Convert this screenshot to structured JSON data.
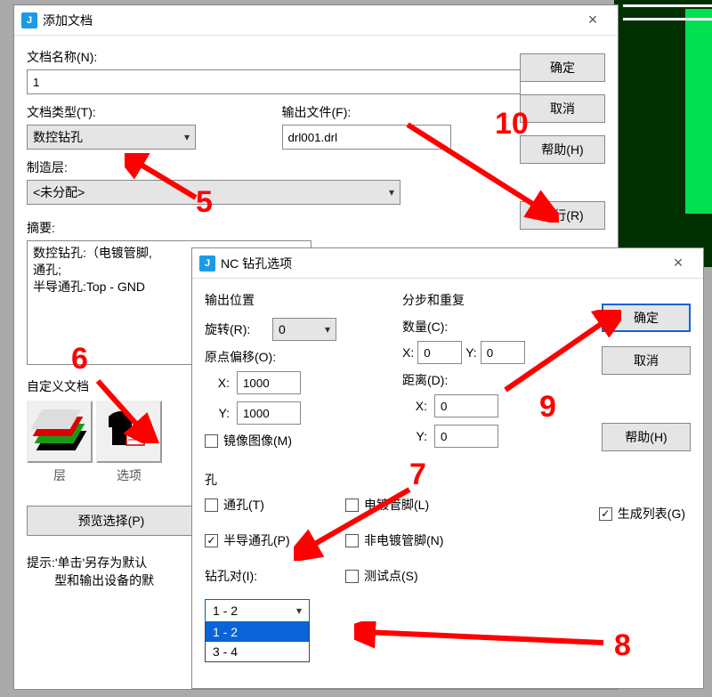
{
  "dlg1": {
    "title": "添加文档",
    "doc_name_label": "文档名称(N):",
    "doc_name_value": "1",
    "doc_type_label": "文档类型(T):",
    "doc_type_value": "数控钻孔",
    "output_file_label": "输出文件(F):",
    "output_file_value": "drl001.drl",
    "make_layer_label": "制造层:",
    "make_layer_value": "<未分配>",
    "summary_label": "摘要:",
    "summary_line1": "数控钻孔:（电镀管脚,",
    "summary_line2": "通孔;",
    "summary_line3": "半导通孔:Top - GND",
    "custom_doc_label": "自定义文档",
    "layer_caption": "层",
    "options_caption": "选项",
    "preview_btn": "预览选择(P)",
    "hint1": "提示:'单击'另存为默认",
    "hint2": "型和输出设备的默",
    "ok": "确定",
    "cancel": "取消",
    "help": "帮助(H)",
    "run": "运行(R)"
  },
  "dlg2": {
    "title": "NC 钻孔选项",
    "output_position": "输出位置",
    "rotation_label": "旋转(R):",
    "rotation_value": "0",
    "origin_offset_label": "原点偏移(O):",
    "origin_x_label": "X:",
    "origin_x_value": "1000",
    "origin_y_label": "Y:",
    "origin_y_value": "1000",
    "mirror_label": "镜像图像(M)",
    "step_repeat": "分步和重复",
    "count_label": "数量(C):",
    "count_x_label": "X:",
    "count_x_value": "0",
    "count_y_label": "Y:",
    "count_y_value": "0",
    "distance_label": "距离(D):",
    "distance_x_value": "0",
    "distance_y_value": "0",
    "hole_section": "孔",
    "through_hole": "通孔(T)",
    "partial_hole": "半导通孔(P)",
    "plated_pin": "电镀管脚(L)",
    "nonplated_pin": "非电镀管脚(N)",
    "test_point": "测试点(S)",
    "drill_pair_label": "钻孔对(I):",
    "drill_pair_value": "1 - 2",
    "drill_pair_options": [
      "1 - 2",
      "3 - 4"
    ],
    "gen_list": "生成列表(G)",
    "ok": "确定",
    "cancel": "取消",
    "help": "帮助(H)"
  },
  "annotations": {
    "n5": "5",
    "n6": "6",
    "n7": "7",
    "n8": "8",
    "n9": "9",
    "n10": "10"
  }
}
